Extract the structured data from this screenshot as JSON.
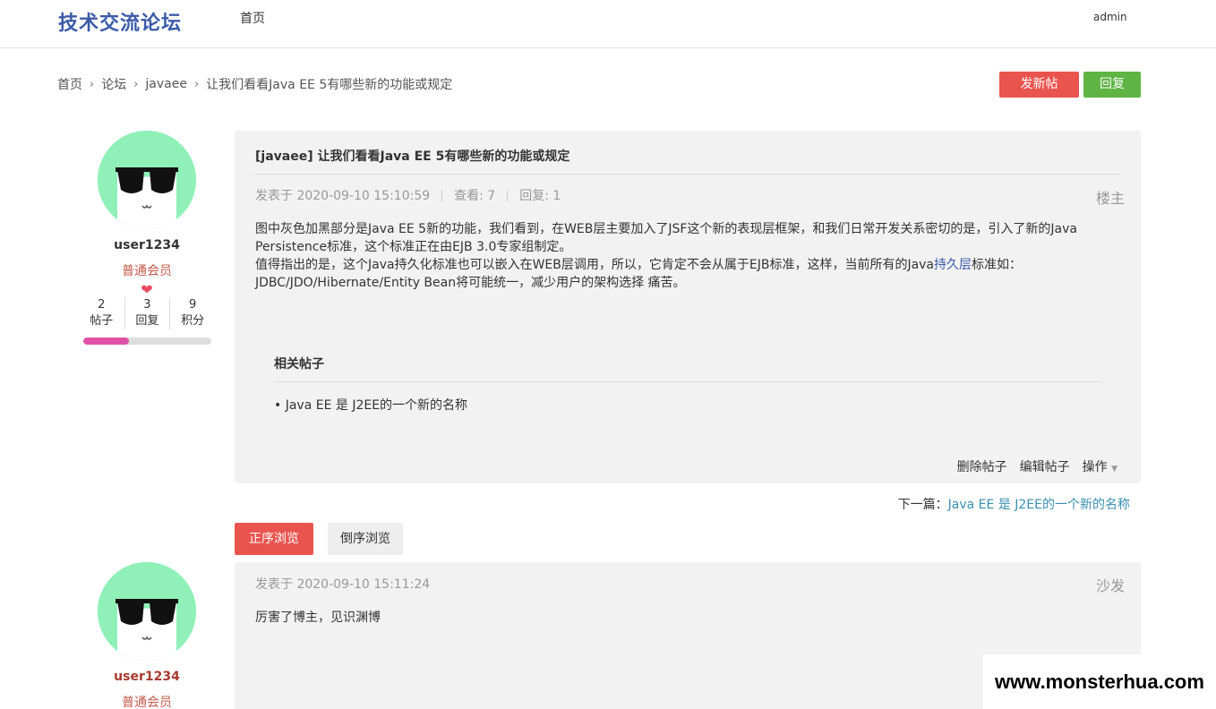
{
  "header": {
    "site_title": "技术交流论坛",
    "nav_home": "首页",
    "user": "admin"
  },
  "breadcrumb": {
    "items": [
      "首页",
      "论坛",
      "javaee",
      "让我们看看Java EE 5有哪些新的功能或规定"
    ],
    "separator": "›"
  },
  "toolbar": {
    "new_post_label": "发新帖",
    "reply_label": "回复"
  },
  "colors": {
    "brand": "#3b5ba8",
    "primary_red": "#e9544f",
    "reply_green": "#5fb444",
    "avatar_bg": "#8ff0b8"
  },
  "post": {
    "author": {
      "username": "user1234",
      "group": "普通会员",
      "icon": "heart-icon",
      "stats": [
        {
          "value": "2",
          "label": "帖子"
        },
        {
          "value": "3",
          "label": "回复"
        },
        {
          "value": "9",
          "label": "积分"
        }
      ],
      "level_fraction": 0.36
    },
    "title": "[javaee] 让我们看看Java EE 5有哪些新的功能或规定",
    "posted_at": "发表于 2020-09-10 15:10:59",
    "views": "查看: 7",
    "replies": "回复: 1",
    "floor": "楼主",
    "body_p1": "图中灰色加黑部分是Java EE 5新的功能，我们看到，在WEB层主要加入了JSF这个新的表现层框架，和我们日常开发关系密切的是，引入了新的Java Persistence标准，这个标准正在由EJB 3.0专家组制定。",
    "body_p2_before": "值得指出的是，这个Java持久化标准也可以嵌入在WEB层调用，所以，它肯定不会从属于EJB标准，这样，当前所有的Java",
    "body_p2_link": "持久层",
    "body_p2_after": "标准如：JDBC/JDO/Hibernate/Entity Bean将可能统一，减少用户的架构选择 痛苦。",
    "related_title": "相关帖子",
    "related_items": [
      "• Java EE 是 J2EE的一个新的名称"
    ],
    "actions": {
      "delete": "删除帖子",
      "edit": "编辑帖子",
      "more": "操作",
      "more_icon": "caret-down-icon"
    }
  },
  "next_post": {
    "label": "下一篇：",
    "title": "Java EE 是 J2EE的一个新的名称"
  },
  "sort": {
    "asc_label": "正序浏览",
    "desc_label": "倒序浏览"
  },
  "reply": {
    "author": {
      "username": "user1234",
      "group": "普通会员"
    },
    "posted_at": "发表于 2020-09-10 15:11:24",
    "floor": "沙发",
    "body": "厉害了博主，见识渊博"
  },
  "watermark": "www.monsterhua.com"
}
